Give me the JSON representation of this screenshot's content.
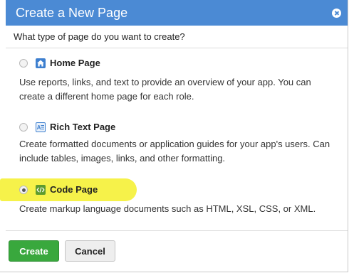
{
  "dialog": {
    "title": "Create a New Page",
    "question": "What type of page do you want to create?"
  },
  "options": [
    {
      "title": "Home Page",
      "icon": "home-icon",
      "selected": false,
      "description": "Use reports, links, and text to provide an overview of your app. You can create a different home page for each role."
    },
    {
      "title": "Rich Text Page",
      "icon": "rich-text-icon",
      "selected": false,
      "description": "Create formatted documents or application guides for your app's users. Can include tables, images, links, and other formatting."
    },
    {
      "title": "Code Page",
      "icon": "code-icon",
      "selected": true,
      "description": "Create markup language documents such as HTML, XSL, CSS, or XML."
    }
  ],
  "buttons": {
    "create": "Create",
    "cancel": "Cancel"
  },
  "colors": {
    "titlebar": "#4b8ad4",
    "create_button": "#39a83d",
    "highlight": "#f6f24a"
  }
}
